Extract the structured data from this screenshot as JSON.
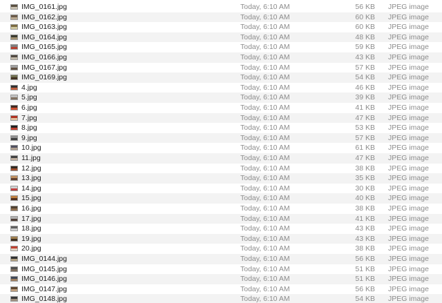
{
  "files": [
    {
      "name": "IMG_0161.jpg",
      "date": "Today, 6:10 AM",
      "size": "56 KB",
      "kind": "JPEG image",
      "icon": "jpeg-thumbnail-icon",
      "thumb_colors": [
        "#5a5040",
        "#c8c0b0"
      ]
    },
    {
      "name": "IMG_0162.jpg",
      "date": "Today, 6:10 AM",
      "size": "60 KB",
      "kind": "JPEG image",
      "icon": "jpeg-thumbnail-icon",
      "thumb_colors": [
        "#6a5a48",
        "#b8a890"
      ]
    },
    {
      "name": "IMG_0163.jpg",
      "date": "Today, 6:10 AM",
      "size": "60 KB",
      "kind": "JPEG image",
      "icon": "jpeg-thumbnail-icon",
      "thumb_colors": [
        "#7a6a40",
        "#d0c8a0"
      ]
    },
    {
      "name": "IMG_0164.jpg",
      "date": "Today, 6:10 AM",
      "size": "48 KB",
      "kind": "JPEG image",
      "icon": "jpeg-thumbnail-icon",
      "thumb_colors": [
        "#3a3a30",
        "#a09070"
      ]
    },
    {
      "name": "IMG_0165.jpg",
      "date": "Today, 6:10 AM",
      "size": "59 KB",
      "kind": "JPEG image",
      "icon": "jpeg-thumbnail-icon",
      "thumb_colors": [
        "#808080",
        "#b84030"
      ]
    },
    {
      "name": "IMG_0166.jpg",
      "date": "Today, 6:10 AM",
      "size": "43 KB",
      "kind": "JPEG image",
      "icon": "jpeg-thumbnail-icon",
      "thumb_colors": [
        "#504840",
        "#c0b8a8"
      ]
    },
    {
      "name": "IMG_0167.jpg",
      "date": "Today, 6:10 AM",
      "size": "57 KB",
      "kind": "JPEG image",
      "icon": "jpeg-thumbnail-icon",
      "thumb_colors": [
        "#a0a0a0",
        "#605040"
      ]
    },
    {
      "name": "IMG_0169.jpg",
      "date": "Today, 6:10 AM",
      "size": "54 KB",
      "kind": "JPEG image",
      "icon": "jpeg-thumbnail-icon",
      "thumb_colors": [
        "#707050",
        "#403020"
      ]
    },
    {
      "name": "4.jpg",
      "date": "Today, 6:10 AM",
      "size": "46 KB",
      "kind": "JPEG image",
      "icon": "jpeg-thumbnail-icon",
      "thumb_colors": [
        "#303030",
        "#c06040"
      ]
    },
    {
      "name": "5.jpg",
      "date": "Today, 6:10 AM",
      "size": "39 KB",
      "kind": "JPEG image",
      "icon": "jpeg-thumbnail-icon",
      "thumb_colors": [
        "#c0c0c0",
        "#807060"
      ]
    },
    {
      "name": "6.jpg",
      "date": "Today, 6:10 AM",
      "size": "41 KB",
      "kind": "JPEG image",
      "icon": "jpeg-thumbnail-icon",
      "thumb_colors": [
        "#402820",
        "#d05030"
      ]
    },
    {
      "name": "7.jpg",
      "date": "Today, 6:10 AM",
      "size": "47 KB",
      "kind": "JPEG image",
      "icon": "jpeg-thumbnail-icon",
      "thumb_colors": [
        "#b03020",
        "#e0c0a0"
      ]
    },
    {
      "name": "8.jpg",
      "date": "Today, 6:10 AM",
      "size": "53 KB",
      "kind": "JPEG image",
      "icon": "jpeg-thumbnail-icon",
      "thumb_colors": [
        "#202020",
        "#c04030"
      ]
    },
    {
      "name": "9.jpg",
      "date": "Today, 6:10 AM",
      "size": "57 KB",
      "kind": "JPEG image",
      "icon": "jpeg-thumbnail-icon",
      "thumb_colors": [
        "#909090",
        "#404040"
      ]
    },
    {
      "name": "10.jpg",
      "date": "Today, 6:10 AM",
      "size": "61 KB",
      "kind": "JPEG image",
      "icon": "jpeg-thumbnail-icon",
      "thumb_colors": [
        "#505060",
        "#b0a090"
      ]
    },
    {
      "name": "11.jpg",
      "date": "Today, 6:10 AM",
      "size": "47 KB",
      "kind": "JPEG image",
      "icon": "jpeg-thumbnail-icon",
      "thumb_colors": [
        "#404040",
        "#c0b0a0"
      ]
    },
    {
      "name": "12.jpg",
      "date": "Today, 6:10 AM",
      "size": "38 KB",
      "kind": "JPEG image",
      "icon": "jpeg-thumbnail-icon",
      "thumb_colors": [
        "#302820",
        "#a05030"
      ]
    },
    {
      "name": "13.jpg",
      "date": "Today, 6:10 AM",
      "size": "35 KB",
      "kind": "JPEG image",
      "icon": "jpeg-thumbnail-icon",
      "thumb_colors": [
        "#c09060",
        "#604030"
      ]
    },
    {
      "name": "14.jpg",
      "date": "Today, 6:10 AM",
      "size": "30 KB",
      "kind": "JPEG image",
      "icon": "jpeg-thumbnail-icon",
      "thumb_colors": [
        "#d0d0d0",
        "#c04040"
      ]
    },
    {
      "name": "15.jpg",
      "date": "Today, 6:10 AM",
      "size": "40 KB",
      "kind": "JPEG image",
      "icon": "jpeg-thumbnail-icon",
      "thumb_colors": [
        "#c08040",
        "#503020"
      ]
    },
    {
      "name": "16.jpg",
      "date": "Today, 6:10 AM",
      "size": "38 KB",
      "kind": "JPEG image",
      "icon": "jpeg-thumbnail-icon",
      "thumb_colors": [
        "#504030",
        "#907050"
      ]
    },
    {
      "name": "17.jpg",
      "date": "Today, 6:10 AM",
      "size": "41 KB",
      "kind": "JPEG image",
      "icon": "jpeg-thumbnail-icon",
      "thumb_colors": [
        "#b0b0b0",
        "#504038"
      ]
    },
    {
      "name": "18.jpg",
      "date": "Today, 6:10 AM",
      "size": "43 KB",
      "kind": "JPEG image",
      "icon": "jpeg-thumbnail-icon",
      "thumb_colors": [
        "#606060",
        "#d0d0d0"
      ]
    },
    {
      "name": "19.jpg",
      "date": "Today, 6:10 AM",
      "size": "43 KB",
      "kind": "JPEG image",
      "icon": "jpeg-thumbnail-icon",
      "thumb_colors": [
        "#a08050",
        "#403020"
      ]
    },
    {
      "name": "20.jpg",
      "date": "Today, 6:10 AM",
      "size": "38 KB",
      "kind": "JPEG image",
      "icon": "jpeg-thumbnail-icon",
      "thumb_colors": [
        "#c04030",
        "#e0d0c0"
      ]
    },
    {
      "name": "IMG_0144.jpg",
      "date": "Today, 6:10 AM",
      "size": "56 KB",
      "kind": "JPEG image",
      "icon": "jpeg-thumbnail-icon",
      "thumb_colors": [
        "#303030",
        "#b0a080"
      ]
    },
    {
      "name": "IMG_0145.jpg",
      "date": "Today, 6:10 AM",
      "size": "51 KB",
      "kind": "JPEG image",
      "icon": "jpeg-thumbnail-icon",
      "thumb_colors": [
        "#505050",
        "#807060"
      ]
    },
    {
      "name": "IMG_0146.jpg",
      "date": "Today, 6:10 AM",
      "size": "51 KB",
      "kind": "JPEG image",
      "icon": "jpeg-thumbnail-icon",
      "thumb_colors": [
        "#404858",
        "#a08060"
      ]
    },
    {
      "name": "IMG_0147.jpg",
      "date": "Today, 6:10 AM",
      "size": "56 KB",
      "kind": "JPEG image",
      "icon": "jpeg-thumbnail-icon",
      "thumb_colors": [
        "#604830",
        "#c0a080"
      ]
    },
    {
      "name": "IMG_0148.jpg",
      "date": "Today, 6:10 AM",
      "size": "54 KB",
      "kind": "JPEG image",
      "icon": "jpeg-thumbnail-icon",
      "thumb_colors": [
        "#383838",
        "#a09080"
      ]
    }
  ],
  "colors": {
    "row_stripe": "#f3f3f3",
    "row_base": "#ffffff",
    "name_text": "#1a1a1a",
    "meta_text": "#8c8c8c"
  }
}
